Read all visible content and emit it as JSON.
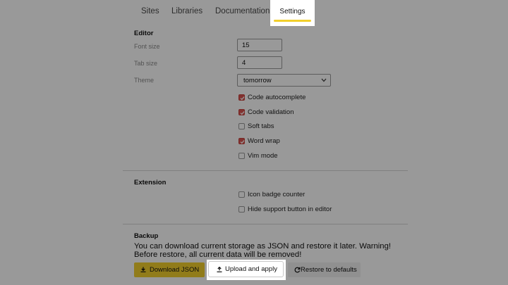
{
  "tabs": [
    {
      "label": "Sites"
    },
    {
      "label": "Libraries"
    },
    {
      "label": "Documentation"
    },
    {
      "label": "Settings",
      "active": true
    }
  ],
  "editor": {
    "title": "Editor",
    "font_size": {
      "label": "Font size",
      "value": "15"
    },
    "tab_size": {
      "label": "Tab size",
      "value": "4"
    },
    "theme": {
      "label": "Theme",
      "value": "tomorrow"
    },
    "options": [
      {
        "label": "Code autocomplete",
        "checked": true
      },
      {
        "label": "Code validation",
        "checked": true
      },
      {
        "label": "Soft tabs",
        "checked": false
      },
      {
        "label": "Word wrap",
        "checked": true
      },
      {
        "label": "Vim mode",
        "checked": false
      }
    ]
  },
  "extension": {
    "title": "Extension",
    "options": [
      {
        "label": "Icon badge counter",
        "checked": false
      },
      {
        "label": "Hide support button in editor",
        "checked": false
      }
    ]
  },
  "backup": {
    "title": "Backup",
    "description": "You can download current storage as JSON and restore it later. Warning! Before restore, all current data will be removed!",
    "download_label": "Download JSON",
    "upload_label": "Upload and apply",
    "restore_label": "Restore to defaults"
  },
  "colors": {
    "accent": "#f2cf2c",
    "checkbox_checked": "#d9534f",
    "overlay": "rgba(0,0,0,0.40)"
  },
  "icons": {
    "download": "download-icon",
    "upload": "upload-icon",
    "restore": "refresh-icon",
    "select": "chevron-down-icon"
  }
}
